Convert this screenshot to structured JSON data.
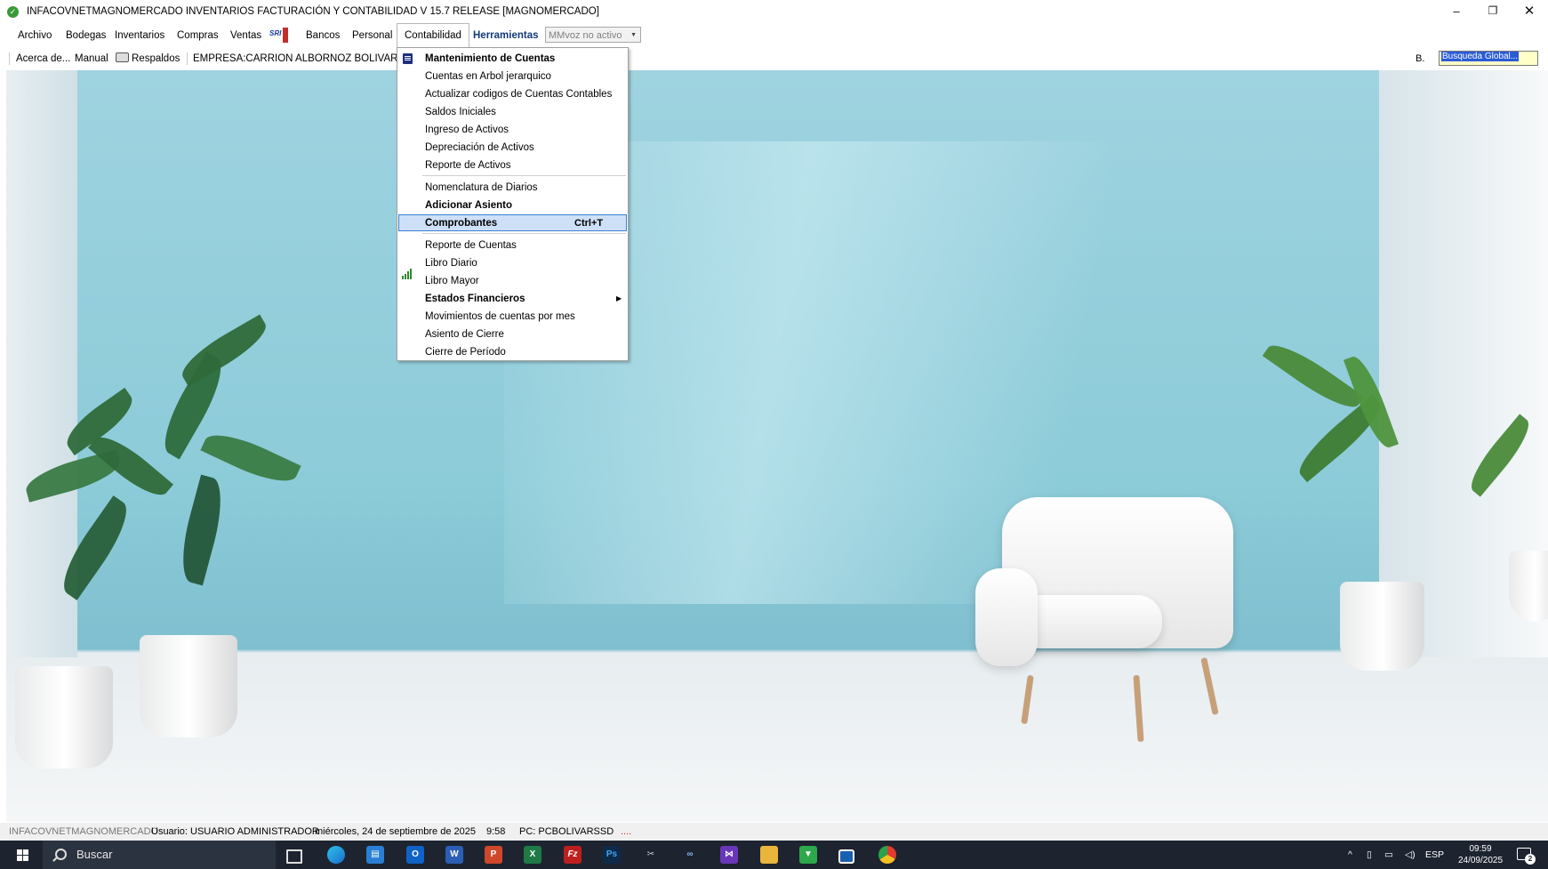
{
  "window": {
    "title": "INFACOVNETMAGNOMERCADO  INVENTARIOS FACTURACIÓN Y CONTABILIDAD V 15.7 RELEASE [MAGNOMERCADO]",
    "minimize": "–",
    "maximize": "❐",
    "close": "✕"
  },
  "menubar": {
    "items": [
      "Archivo",
      "Bodegas",
      "Inventarios",
      "Compras",
      "Ventas",
      "Bancos",
      "Personal",
      "Contabilidad",
      "Herramientas"
    ],
    "sri_label": "SRI",
    "voice_combo": "MMvoz no activo"
  },
  "toolbar": {
    "about": "Acerca de...",
    "manual": "Manual",
    "backups": "Respaldos",
    "company": "EMPRESA:CARRION ALBORNOZ BOLIVAR ALFR",
    "search_label": "B.",
    "search_value": "Busqueda Global..."
  },
  "dropdown": {
    "items": [
      {
        "label": "Mantenimiento de Cuentas",
        "bold": true
      },
      {
        "label": "Cuentas en Arbol jerarquico"
      },
      {
        "label": "Actualizar codigos de Cuentas Contables"
      },
      {
        "label": "Saldos Iniciales"
      },
      {
        "label": "Ingreso de Activos"
      },
      {
        "label": "Depreciación de Activos"
      },
      {
        "label": "Reporte de Activos"
      },
      {
        "label": "Nomenclatura de Diarios"
      },
      {
        "label": "Adicionar Asiento",
        "bold": true
      },
      {
        "label": "Comprobantes",
        "bold": true,
        "shortcut": "Ctrl+T",
        "highlighted": true
      },
      {
        "label": "Reporte de Cuentas"
      },
      {
        "label": "Libro Diario"
      },
      {
        "label": "Libro Mayor"
      },
      {
        "label": "Estados Financieros",
        "bold": true,
        "submenu": true
      },
      {
        "label": "Movimientos de cuentas por mes"
      },
      {
        "label": "Asiento de Cierre"
      },
      {
        "label": "Cierre de Período"
      }
    ]
  },
  "statusbar": {
    "app": "INFACOVNETMAGNOMERCADO",
    "user": "Usuario: USUARIO ADMINISTRADOR",
    "date": "miércoles, 24 de septiembre de 2025",
    "time": "9:58",
    "pc": "PC: PCBOLIVARSSD",
    "dots": "...."
  },
  "taskbar": {
    "search_placeholder": "Buscar",
    "language": "ESP",
    "clock_time": "09:59",
    "clock_date": "24/09/2025",
    "notifications": "2",
    "apps": [
      "task-view",
      "edge",
      "store",
      "outlook",
      "word",
      "powerpoint",
      "excel",
      "filezilla",
      "photoshop",
      "tools",
      "vs-code-alt",
      "visual-studio",
      "file-explorer",
      "green-app",
      "window-app",
      "chrome"
    ]
  },
  "colors": {
    "menu_highlight": "#cde0f7",
    "menu_highlight_border": "#3c7fd6",
    "taskbar": "#1d2430",
    "wall": "#8ccbd8"
  }
}
